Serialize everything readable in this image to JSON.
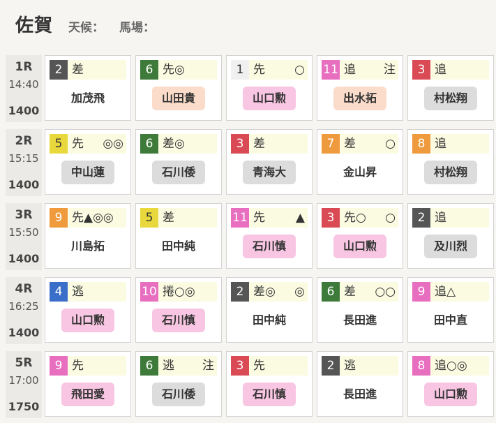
{
  "header": {
    "title": "佐賀",
    "weather": "天候：",
    "track": "馬場："
  },
  "races": [
    {
      "race": "1R",
      "time": "14:40",
      "distance": "1400",
      "entries": [
        {
          "num": "2",
          "num_color": "#555555",
          "style": "差",
          "mark": "",
          "jockey": "加茂飛",
          "tag": "plain"
        },
        {
          "num": "6",
          "num_color": "#3e7b3a",
          "style": "先◎",
          "mark": "",
          "jockey": "山田貴",
          "tag": "peach"
        },
        {
          "num": "1",
          "num_color": "#f0f0f0",
          "style": "先",
          "mark": "○",
          "jockey": "山口勲",
          "tag": "pink"
        },
        {
          "num": "11",
          "num_color": "#e86ec0",
          "style": "追",
          "mark": "注",
          "jockey": "出水拓",
          "tag": "peach"
        },
        {
          "num": "3",
          "num_color": "#d94a55",
          "style": "追",
          "mark": "",
          "jockey": "村松翔",
          "tag": "gray"
        }
      ]
    },
    {
      "race": "2R",
      "time": "15:15",
      "distance": "1400",
      "entries": [
        {
          "num": "5",
          "num_color": "#e9d83c",
          "style": "先",
          "mark": "◎◎",
          "jockey": "中山蓮",
          "tag": "gray"
        },
        {
          "num": "6",
          "num_color": "#3e7b3a",
          "style": "差◎",
          "mark": "",
          "jockey": "石川倭",
          "tag": "gray"
        },
        {
          "num": "3",
          "num_color": "#d94a55",
          "style": "差",
          "mark": "",
          "jockey": "青海大",
          "tag": "gray"
        },
        {
          "num": "7",
          "num_color": "#ee9a3d",
          "style": "差",
          "mark": "○",
          "jockey": "金山昇",
          "tag": "plain"
        },
        {
          "num": "8",
          "num_color": "#ee9a3d",
          "style": "追",
          "mark": "",
          "jockey": "村松翔",
          "tag": "gray"
        }
      ]
    },
    {
      "race": "3R",
      "time": "15:50",
      "distance": "1400",
      "entries": [
        {
          "num": "9",
          "num_color": "#ee9a3d",
          "style": "先▲◎◎",
          "mark": "",
          "jockey": "川島拓",
          "tag": "plain"
        },
        {
          "num": "5",
          "num_color": "#e9d83c",
          "style": "差",
          "mark": "",
          "jockey": "田中純",
          "tag": "plain"
        },
        {
          "num": "11",
          "num_color": "#e86ec0",
          "style": "先",
          "mark": "▲",
          "jockey": "石川慎",
          "tag": "pink"
        },
        {
          "num": "3",
          "num_color": "#d94a55",
          "style": "先○",
          "mark": "○",
          "jockey": "山口勲",
          "tag": "pink"
        },
        {
          "num": "2",
          "num_color": "#555555",
          "style": "追",
          "mark": "",
          "jockey": "及川烈",
          "tag": "gray"
        }
      ]
    },
    {
      "race": "4R",
      "time": "16:25",
      "distance": "1400",
      "entries": [
        {
          "num": "4",
          "num_color": "#3a6fc9",
          "style": "逃",
          "mark": "",
          "jockey": "山口勲",
          "tag": "pink"
        },
        {
          "num": "10",
          "num_color": "#e86ec0",
          "style": "捲○◎",
          "mark": "",
          "jockey": "石川慎",
          "tag": "pink"
        },
        {
          "num": "2",
          "num_color": "#555555",
          "style": "差◎",
          "mark": "◎",
          "jockey": "田中純",
          "tag": "plain"
        },
        {
          "num": "6",
          "num_color": "#3e7b3a",
          "style": "差",
          "mark": "○○",
          "jockey": "長田進",
          "tag": "plain"
        },
        {
          "num": "9",
          "num_color": "#e86ec0",
          "style": "追△",
          "mark": "",
          "jockey": "田中直",
          "tag": "plain"
        }
      ]
    },
    {
      "race": "5R",
      "time": "17:00",
      "distance": "1750",
      "entries": [
        {
          "num": "9",
          "num_color": "#e86ec0",
          "style": "先",
          "mark": "",
          "jockey": "飛田愛",
          "tag": "pink"
        },
        {
          "num": "6",
          "num_color": "#3e7b3a",
          "style": "逃",
          "mark": "注",
          "jockey": "石川倭",
          "tag": "gray"
        },
        {
          "num": "3",
          "num_color": "#d94a55",
          "style": "先",
          "mark": "",
          "jockey": "石川慎",
          "tag": "pink"
        },
        {
          "num": "2",
          "num_color": "#555555",
          "style": "逃",
          "mark": "",
          "jockey": "長田進",
          "tag": "plain"
        },
        {
          "num": "8",
          "num_color": "#e86ec0",
          "style": "追○◎",
          "mark": "",
          "jockey": "山口勲",
          "tag": "pink"
        }
      ]
    }
  ]
}
